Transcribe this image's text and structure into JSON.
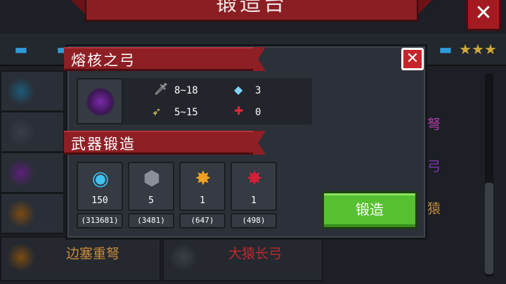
{
  "background": {
    "title": "锻造台",
    "close_symbol": "✕",
    "list_right_names": [
      {
        "text": "弩",
        "color": "#b03aa8"
      },
      {
        "text": "弓",
        "color": "#7a3ab0"
      },
      {
        "text": "猿",
        "color": "#c48a3a"
      }
    ],
    "bottom_items": [
      {
        "name": "边塞重弩",
        "color": "#c98a3a"
      },
      {
        "name": "大猿长弓",
        "color": "#c0282e"
      }
    ]
  },
  "dialog": {
    "weapon_name": "熔核之弓",
    "close_symbol": "✕",
    "weapon_icon": "bow-icon",
    "stats": {
      "damage": "8~18",
      "energy": "5~15",
      "energy_cost": "3",
      "crit": "0"
    },
    "section_title": "武器锻造",
    "materials": [
      {
        "icon": "blue-orb-icon",
        "glyph": "◉",
        "color": "#3fc4f0",
        "required": "150",
        "owned": "(313681)"
      },
      {
        "icon": "iron-ore-icon",
        "glyph": "⬢",
        "color": "#8a8f99",
        "required": "5",
        "owned": "(3481)"
      },
      {
        "icon": "orange-maple-leaf-icon",
        "glyph": "✸",
        "color": "#f2a020",
        "required": "1",
        "owned": "(647)"
      },
      {
        "icon": "red-maple-leaf-icon",
        "glyph": "✸",
        "color": "#d3203a",
        "required": "1",
        "owned": "(498)"
      }
    ],
    "forge_button": "锻造"
  }
}
